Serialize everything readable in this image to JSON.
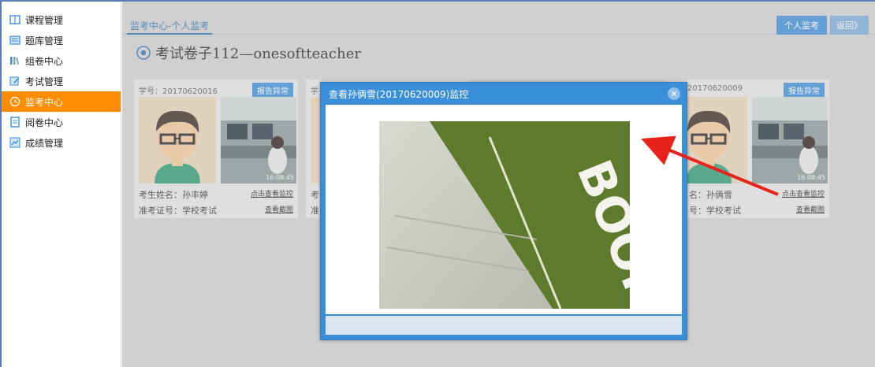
{
  "sidebar": {
    "items": [
      {
        "label": "课程管理",
        "icon": "book-icon",
        "active": false
      },
      {
        "label": "题库管理",
        "icon": "question-bank-icon",
        "active": false
      },
      {
        "label": "组卷中心",
        "icon": "paper-compose-icon",
        "active": false
      },
      {
        "label": "考试管理",
        "icon": "exam-manage-icon",
        "active": false
      },
      {
        "label": "监考中心",
        "icon": "clock-icon",
        "active": true
      },
      {
        "label": "阅卷中心",
        "icon": "grading-icon",
        "active": false
      },
      {
        "label": "成绩管理",
        "icon": "score-icon",
        "active": false
      }
    ]
  },
  "header": {
    "tab": "监考中心-个人监考",
    "btn_personal": "个人监考",
    "btn_back": "返回》"
  },
  "exam": {
    "title": "考试卷子112—onesoftteacher"
  },
  "cards": [
    {
      "sid": "学号：20170620016",
      "report": "报告异常",
      "time": "16:08:45",
      "name": "考生姓名：孙丰婷",
      "zk": "准考证号：学校考试",
      "link1": "点击查看监控",
      "link2": "查看截图"
    },
    {
      "sid": "学",
      "report": "",
      "time": "",
      "name": "考",
      "zk": "准",
      "link1": "",
      "link2": ""
    },
    {
      "sid": "20170620009",
      "report": "报告异常",
      "time": "16:08:45",
      "name": "名：孙俩雪",
      "zk": "号：学校考试",
      "link1": "点击查看监控",
      "link2": "查看截图"
    }
  ],
  "modal": {
    "title": "查看孙俩雪(20170620009)监控",
    "close_icon": "close-icon",
    "feed_text": "BOOK"
  },
  "colors": {
    "accent": "#ff8c00",
    "primary": "#3b8ed8",
    "arrow": "#e8231b"
  }
}
